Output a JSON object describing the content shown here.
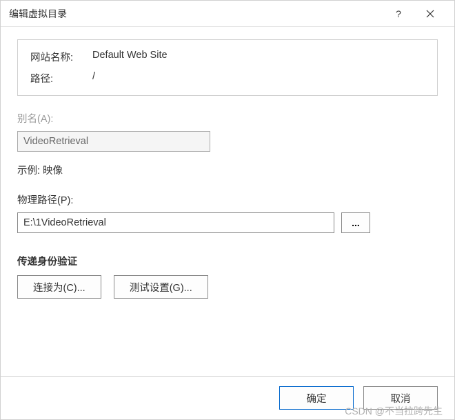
{
  "titlebar": {
    "title": "编辑虚拟目录",
    "help_icon": "help",
    "close_icon": "close"
  },
  "info": {
    "site_name_label": "网站名称:",
    "site_name_value": "Default Web Site",
    "path_label": "路径:",
    "path_value": "/"
  },
  "alias": {
    "label": "别名(A):",
    "value": "VideoRetrieval"
  },
  "example": {
    "text": "示例: 映像"
  },
  "physical_path": {
    "label": "物理路径(P):",
    "value": "E:\\1VideoRetrieval",
    "browse_label": "..."
  },
  "auth": {
    "section_label": "传递身份验证",
    "connect_as_label": "连接为(C)...",
    "test_settings_label": "测试设置(G)..."
  },
  "footer": {
    "ok_label": "确定",
    "cancel_label": "取消"
  },
  "watermark": "CSDN @不当拉跨先生"
}
